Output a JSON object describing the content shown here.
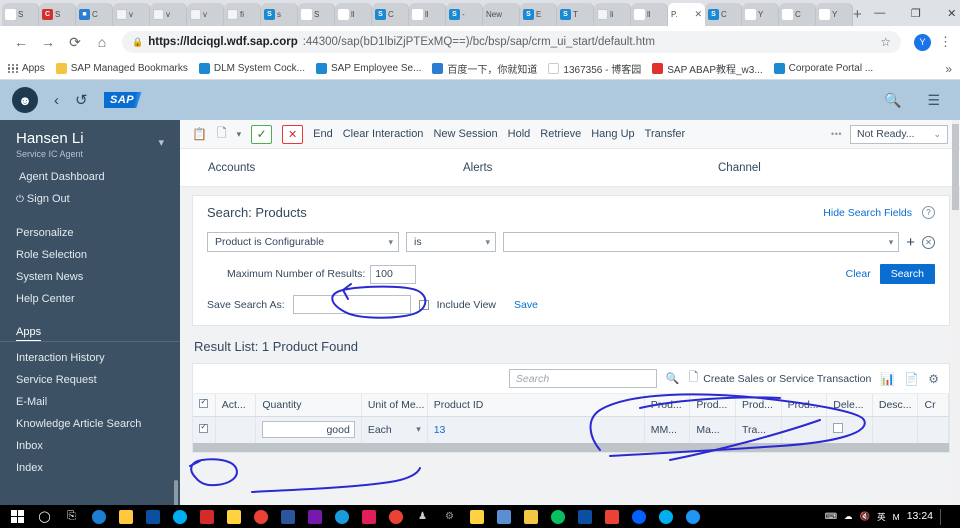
{
  "browser": {
    "tabs": [
      {
        "label": "S",
        "icon": "person-icon",
        "style": "fv-person",
        "active": false
      },
      {
        "label": "S",
        "icon": "c-icon",
        "style": "fv-red",
        "active": false
      },
      {
        "label": "C",
        "icon": "doc-icon",
        "style": "fv-blue",
        "active": false
      },
      {
        "label": "v",
        "icon": "page-icon",
        "style": "fv-white",
        "active": false
      },
      {
        "label": "v",
        "icon": "page-icon",
        "style": "fv-white",
        "active": false
      },
      {
        "label": "v",
        "icon": "page-icon",
        "style": "fv-white",
        "active": false
      },
      {
        "label": "fi",
        "icon": "page-icon",
        "style": "fv-white",
        "active": false
      },
      {
        "label": "s",
        "icon": "sap-icon",
        "style": "fv-sap",
        "active": false
      },
      {
        "label": "S",
        "icon": "chinese-icon",
        "style": "fv-orange",
        "active": false
      },
      {
        "label": "ll",
        "icon": "person-icon",
        "style": "fv-person",
        "active": false
      },
      {
        "label": "C",
        "icon": "sap-icon",
        "style": "fv-sap",
        "active": false
      },
      {
        "label": "ll",
        "icon": "person-icon",
        "style": "fv-person",
        "active": false
      },
      {
        "label": "-",
        "icon": "sap-icon",
        "style": "fv-sap",
        "active": false
      },
      {
        "label": "New",
        "icon": "none",
        "style": "fv-none",
        "active": false
      },
      {
        "label": "E",
        "icon": "sap-icon",
        "style": "fv-sap",
        "active": false
      },
      {
        "label": "T",
        "icon": "sap-icon",
        "style": "fv-sap",
        "active": false
      },
      {
        "label": "li",
        "icon": "page-icon",
        "style": "fv-white",
        "active": false
      },
      {
        "label": "ll",
        "icon": "person-icon",
        "style": "fv-person",
        "active": false
      },
      {
        "label": "P.",
        "icon": "none",
        "style": "fv-none",
        "active": true
      },
      {
        "label": "C",
        "icon": "sap-icon",
        "style": "fv-sap",
        "active": false
      },
      {
        "label": "Y",
        "icon": "slack-icon",
        "style": "fv-slack",
        "active": false
      },
      {
        "label": "C",
        "icon": "slack-icon",
        "style": "fv-slack",
        "active": false
      },
      {
        "label": "Y",
        "icon": "slack-icon",
        "style": "fv-slack",
        "active": false
      }
    ],
    "new_tab_label": "+",
    "window_controls": {
      "minimize": "—",
      "maximize": "❐",
      "close": "✕"
    },
    "nav": {
      "back": "←",
      "forward": "→",
      "reload": "⟳",
      "home": "⌂"
    },
    "url_host": "https://ldciqgl.wdf.sap.corp",
    "url_rest": ":44300/sap(bD1lbiZjPTExMQ==)/bc/bsp/sap/crm_ui_start/default.htm",
    "star_icon": "☆",
    "profile_initial": "Y",
    "menu_icon": "⋮",
    "bookmarks": [
      {
        "label": "Apps",
        "color": "#5f6368"
      },
      {
        "label": "SAP Managed Bookmarks",
        "color": "#f4c542"
      },
      {
        "label": "DLM System Cock...",
        "color": "#1c8ad1"
      },
      {
        "label": "SAP Employee Se...",
        "color": "#1c8ad1"
      },
      {
        "label": "百度一下，你就知道",
        "color": "#2b7cd3"
      },
      {
        "label": "1367356 - 博客园",
        "color": "#ffffff"
      },
      {
        "label": "SAP ABAP教程_w3...",
        "color": "#e03131"
      },
      {
        "label": "Corporate Portal ...",
        "color": "#1c8ad1"
      }
    ],
    "bookmarks_overflow": "»"
  },
  "sap": {
    "topbar": {
      "avatar_icon": "person-icon",
      "back_icon": "‹",
      "history_icon": "⌚",
      "logo_text": "SAP",
      "search_icon": "search-icon",
      "menu_icon": "menu-icon"
    },
    "sidebar": {
      "user_name": "Hansen Li",
      "user_role": "Service IC Agent",
      "links_top": [
        {
          "label": "Agent Dashboard",
          "sub": true
        },
        {
          "label": "Sign Out",
          "power": true
        }
      ],
      "links_mid": [
        {
          "label": "Personalize"
        },
        {
          "label": "Role Selection"
        },
        {
          "label": "System News"
        },
        {
          "label": "Help Center"
        }
      ],
      "apps_header": "Apps",
      "apps": [
        {
          "label": "Interaction History"
        },
        {
          "label": "Service Request"
        },
        {
          "label": "E-Mail"
        },
        {
          "label": "Knowledge Article Search"
        },
        {
          "label": "Inbox"
        },
        {
          "label": "Index"
        }
      ]
    },
    "ic_toolbar": {
      "icon_clipboard": "clipboard-icon",
      "icon_list": "list-icon",
      "icon_chevron": "chevron-down-icon",
      "accept_label": "✓",
      "reject_label": "✕",
      "links": [
        "End",
        "Clear Interaction",
        "New Session",
        "Hold",
        "Retrieve",
        "Hang Up",
        "Transfer"
      ],
      "overflow": "•••",
      "status_value": "Not Ready...",
      "status_chevron": "⌄"
    },
    "nav_links": [
      "Accounts",
      "Alerts",
      "Channel"
    ],
    "search_panel": {
      "title": "Search: Products",
      "hide_fields_label": "Hide Search Fields",
      "help_icon": "?",
      "criteria": {
        "field_value": "Product is Configurable",
        "operator_value": "is",
        "value_value": ""
      },
      "add_icon": "+",
      "remove_icon": "✕",
      "max_results_label": "Maximum Number of Results:",
      "max_results_value": "100",
      "clear_label": "Clear",
      "search_label": "Search",
      "save_search_label": "Save Search As:",
      "save_search_value": "",
      "include_view_label": "Include View",
      "save_label": "Save"
    },
    "result_list": {
      "title": "Result List: 1 Product Found",
      "toolbar": {
        "search_placeholder": "Search",
        "search_value": "",
        "search_icon": "search-icon",
        "create_label": "Create Sales or Service Transaction",
        "create_icon": "new-doc-icon",
        "chart_icon": "chart-icon",
        "export_icon": "export-icon",
        "settings_icon": "gear-icon"
      },
      "columns": [
        "",
        "Act...",
        "Quantity",
        "Unit of Me...",
        "Product ID",
        "Prod...",
        "Prod...",
        "Prod...",
        "Prod...",
        "Dele...",
        "Desc...",
        "Cr"
      ],
      "rows": [
        {
          "selected": true,
          "action": "",
          "quantity": "good",
          "unit_of_measure": "Each",
          "product_id": "13",
          "prod_1": "MM...",
          "prod_2": "Ma...",
          "prod_3": "Tra...",
          "prod_4": "",
          "deletion": "",
          "description": "",
          "created": ""
        }
      ]
    }
  },
  "taskbar": {
    "start_icon": "windows-icon",
    "search_icon": "search-icon",
    "taskview_icon": "task-view-icon",
    "apps": [
      {
        "name": "edge-icon",
        "color": "#1b7fd4"
      },
      {
        "name": "file-explorer-icon",
        "color": "#ffc83d"
      },
      {
        "name": "outlook-icon",
        "color": "#0a4fa0"
      },
      {
        "name": "skype-icon",
        "color": "#00aff0"
      },
      {
        "name": "acrobat-icon",
        "color": "#d42a2a"
      },
      {
        "name": "sap-logon-icon",
        "color": "#ffd23f"
      },
      {
        "name": "chrome-icon",
        "color": "#ea4335"
      },
      {
        "name": "word-icon",
        "color": "#2b579a"
      },
      {
        "name": "onenote-icon",
        "color": "#7719aa"
      },
      {
        "name": "ie-icon",
        "color": "#1a9bdc"
      },
      {
        "name": "slack-icon",
        "color": "#e01e5a"
      },
      {
        "name": "chrome2-icon",
        "color": "#ea4335"
      },
      {
        "name": "people-icon",
        "color": "#cccccc"
      },
      {
        "name": "settings-icon",
        "color": "#8a8a8a"
      },
      {
        "name": "sap-logon2-icon",
        "color": "#ffd23f"
      },
      {
        "name": "teams-icon",
        "color": "#5b5fc7"
      },
      {
        "name": "mail-icon",
        "color": "#f2c744"
      },
      {
        "name": "wechat-icon",
        "color": "#07c160"
      },
      {
        "name": "outlook2-icon",
        "color": "#0a4fa0"
      },
      {
        "name": "gmail-icon",
        "color": "#ea4335"
      },
      {
        "name": "dropbox-icon",
        "color": "#0061ff"
      },
      {
        "name": "sync-icon",
        "color": "#00b0f0"
      },
      {
        "name": "bluetooth-icon",
        "color": "#2196f3"
      }
    ],
    "tray": {
      "keyboard_icon": "keyboard-icon",
      "network_icon": "wifi-icon",
      "volume_icon": "volume-muted-icon",
      "ime_label": "英",
      "ime2_label": "M",
      "time": "13:24",
      "show_desktop": "show-desktop-icon"
    }
  }
}
